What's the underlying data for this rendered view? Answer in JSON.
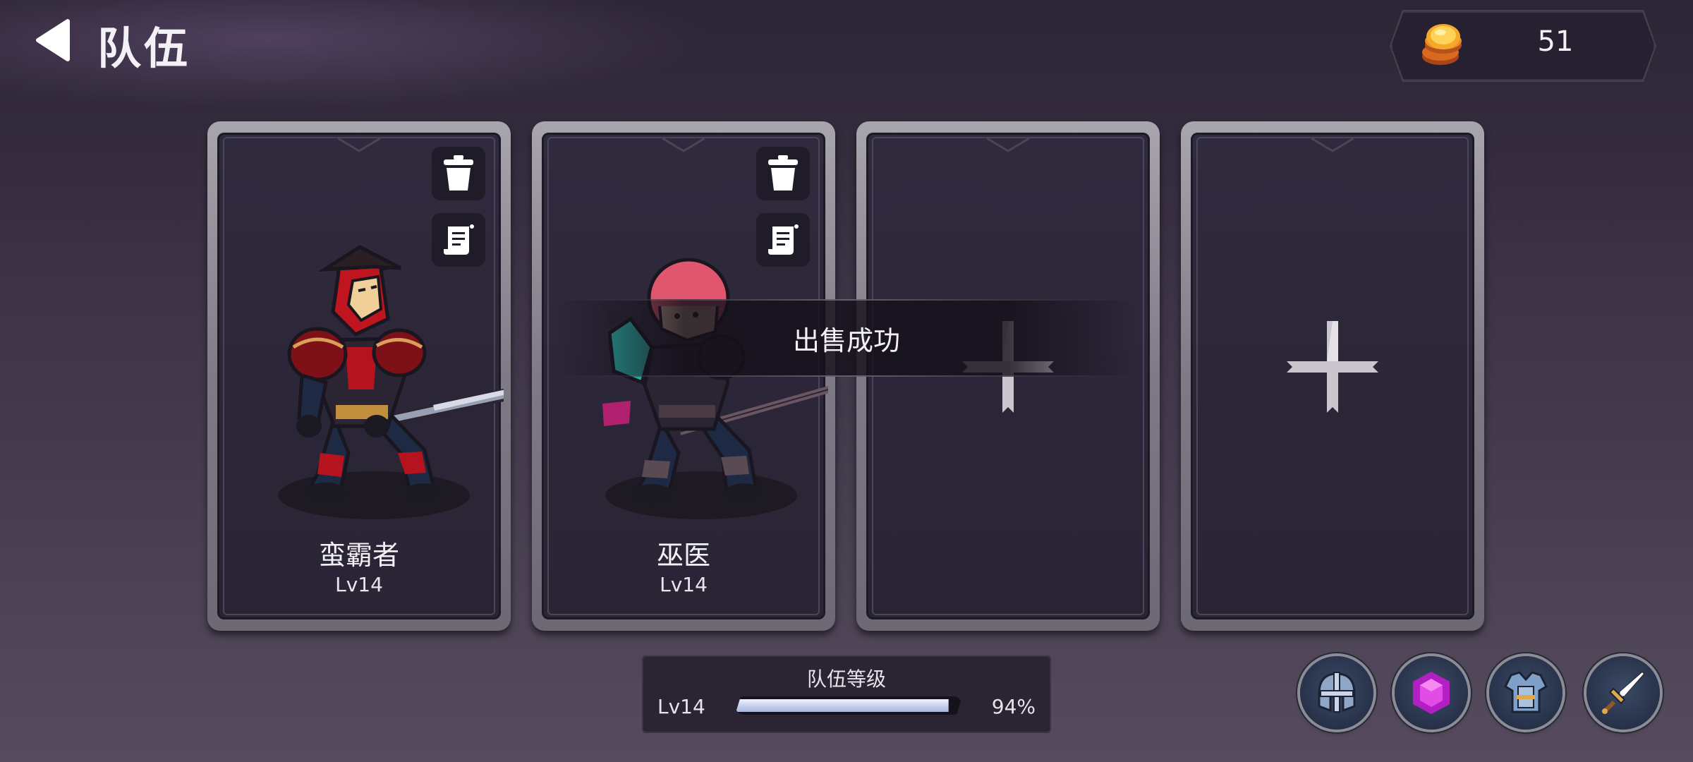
{
  "header": {
    "title": "队伍",
    "back_icon": "back-arrow-icon"
  },
  "currency": {
    "icon": "gold-coin-icon",
    "amount": "51"
  },
  "team_slots": [
    {
      "type": "hero",
      "name": "蛮霸者",
      "level": "Lv14",
      "actions": [
        "trash-icon",
        "scroll-details-icon"
      ]
    },
    {
      "type": "hero",
      "name": "巫医",
      "level": "Lv14",
      "actions": [
        "trash-icon",
        "scroll-details-icon"
      ]
    },
    {
      "type": "empty",
      "icon": "plus-icon"
    },
    {
      "type": "empty",
      "icon": "plus-icon"
    }
  ],
  "toast": {
    "message": "出售成功"
  },
  "team_level": {
    "title": "队伍等级",
    "level": "Lv14",
    "progress": 0.94,
    "percent_label": "94%"
  },
  "bottom_actions": [
    {
      "icon": "helmet-icon"
    },
    {
      "icon": "purple-gem-icon"
    },
    {
      "icon": "armor-vest-icon"
    },
    {
      "icon": "sword-icon"
    }
  ],
  "colors": {
    "progress_fill": "#c3cdea",
    "coin": "#f2a12a",
    "gem": "#d43ee0"
  }
}
